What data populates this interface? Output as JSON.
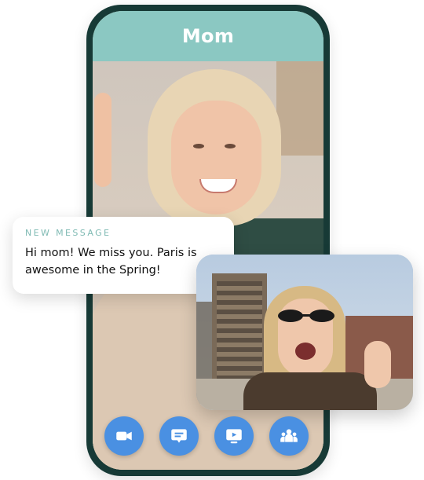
{
  "call": {
    "contact_name": "Mom"
  },
  "notification": {
    "title": "NEW MESSAGE",
    "text": "Hi mom! We miss you. Paris is awesome in the Spring!"
  },
  "controls": [
    {
      "name": "video-camera-icon"
    },
    {
      "name": "message-icon"
    },
    {
      "name": "screen-share-icon"
    },
    {
      "name": "participants-icon"
    }
  ],
  "colors": {
    "header": "#8bc8c2",
    "frame": "#173a36",
    "button": "#4a90e2",
    "notification_title": "#7fbab3"
  }
}
